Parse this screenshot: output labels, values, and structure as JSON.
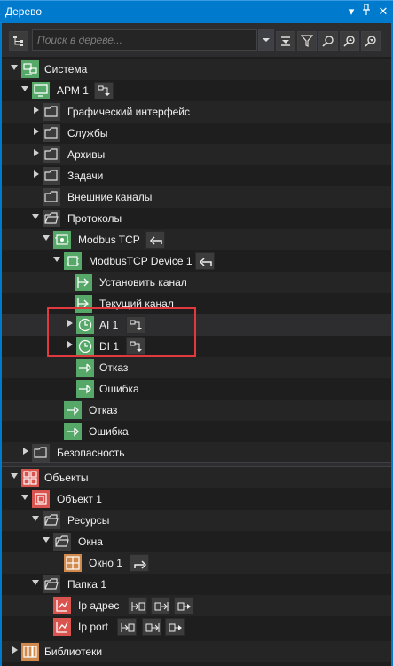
{
  "window": {
    "title": "Дерево"
  },
  "toolbar": {
    "search_placeholder": "Поиск в дереве..."
  },
  "tree": {
    "sistema": "Система",
    "arm1": "АРМ 1",
    "gui": "Графический интерфейс",
    "services": "Службы",
    "archives": "Архивы",
    "tasks": "Задачи",
    "ext_channels": "Внешние каналы",
    "protocols": "Протоколы",
    "modbus_tcp": "Modbus TCP",
    "modbus_device": "ModbusTCP Device 1",
    "set_channel": "Установить канал",
    "current_channel": "Текущий канал",
    "ai1": "AI 1",
    "di1": "DI 1",
    "fail_inner": "Отказ",
    "error_inner": "Ошибка",
    "fail_outer": "Отказ",
    "error_outer": "Ошибка",
    "security": "Безопасность",
    "objects": "Объекты",
    "object1": "Объект 1",
    "resources": "Ресурсы",
    "windows": "Окна",
    "window1": "Окно 1",
    "folder1": "Папка 1",
    "ip_addr": "Ip адрес",
    "ip_port": "Ip port",
    "libraries": "Библиотеки"
  },
  "colors": {
    "accent": "#007acc",
    "green_icon": "#55a868",
    "red_icon": "#d9534f",
    "orange_icon": "#d08a4e",
    "highlight": "#e0393e"
  }
}
